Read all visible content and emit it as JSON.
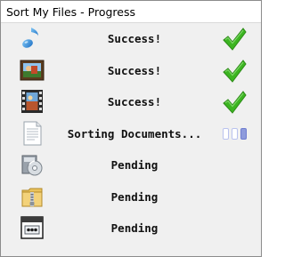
{
  "window": {
    "title": "Sort My Files - Progress"
  },
  "rows": [
    {
      "icon": "music-note-icon",
      "status_text": "Success!",
      "state": "success"
    },
    {
      "icon": "photo-album-icon",
      "status_text": "Success!",
      "state": "success"
    },
    {
      "icon": "film-strip-icon",
      "status_text": "Success!",
      "state": "success"
    },
    {
      "icon": "document-page-icon",
      "status_text": "Sorting Documents...",
      "state": "in-progress"
    },
    {
      "icon": "software-installer-icon",
      "status_text": "Pending",
      "state": "pending"
    },
    {
      "icon": "zip-folder-icon",
      "status_text": "Pending",
      "state": "pending"
    },
    {
      "icon": "application-window-icon",
      "status_text": "Pending",
      "state": "pending"
    }
  ],
  "colors": {
    "check_green": "#3cb521",
    "progress_blue": "#8e9bdc"
  },
  "progress_indicator": {
    "segments": 3,
    "active_segment": 3
  }
}
